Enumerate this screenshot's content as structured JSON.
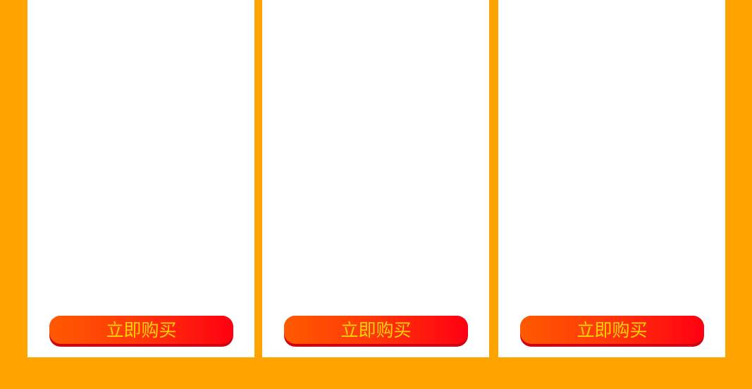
{
  "colors": {
    "page_background": "#FFA300",
    "card_background": "#FFFFFF",
    "button_gradient_start": "#FF5A00",
    "button_gradient_end": "#FF0012",
    "button_shadow": "#D10012",
    "button_text": "#FFD400"
  },
  "products": [
    {
      "buy_label": "立即购买"
    },
    {
      "buy_label": "立即购买"
    },
    {
      "buy_label": "立即购买"
    }
  ]
}
